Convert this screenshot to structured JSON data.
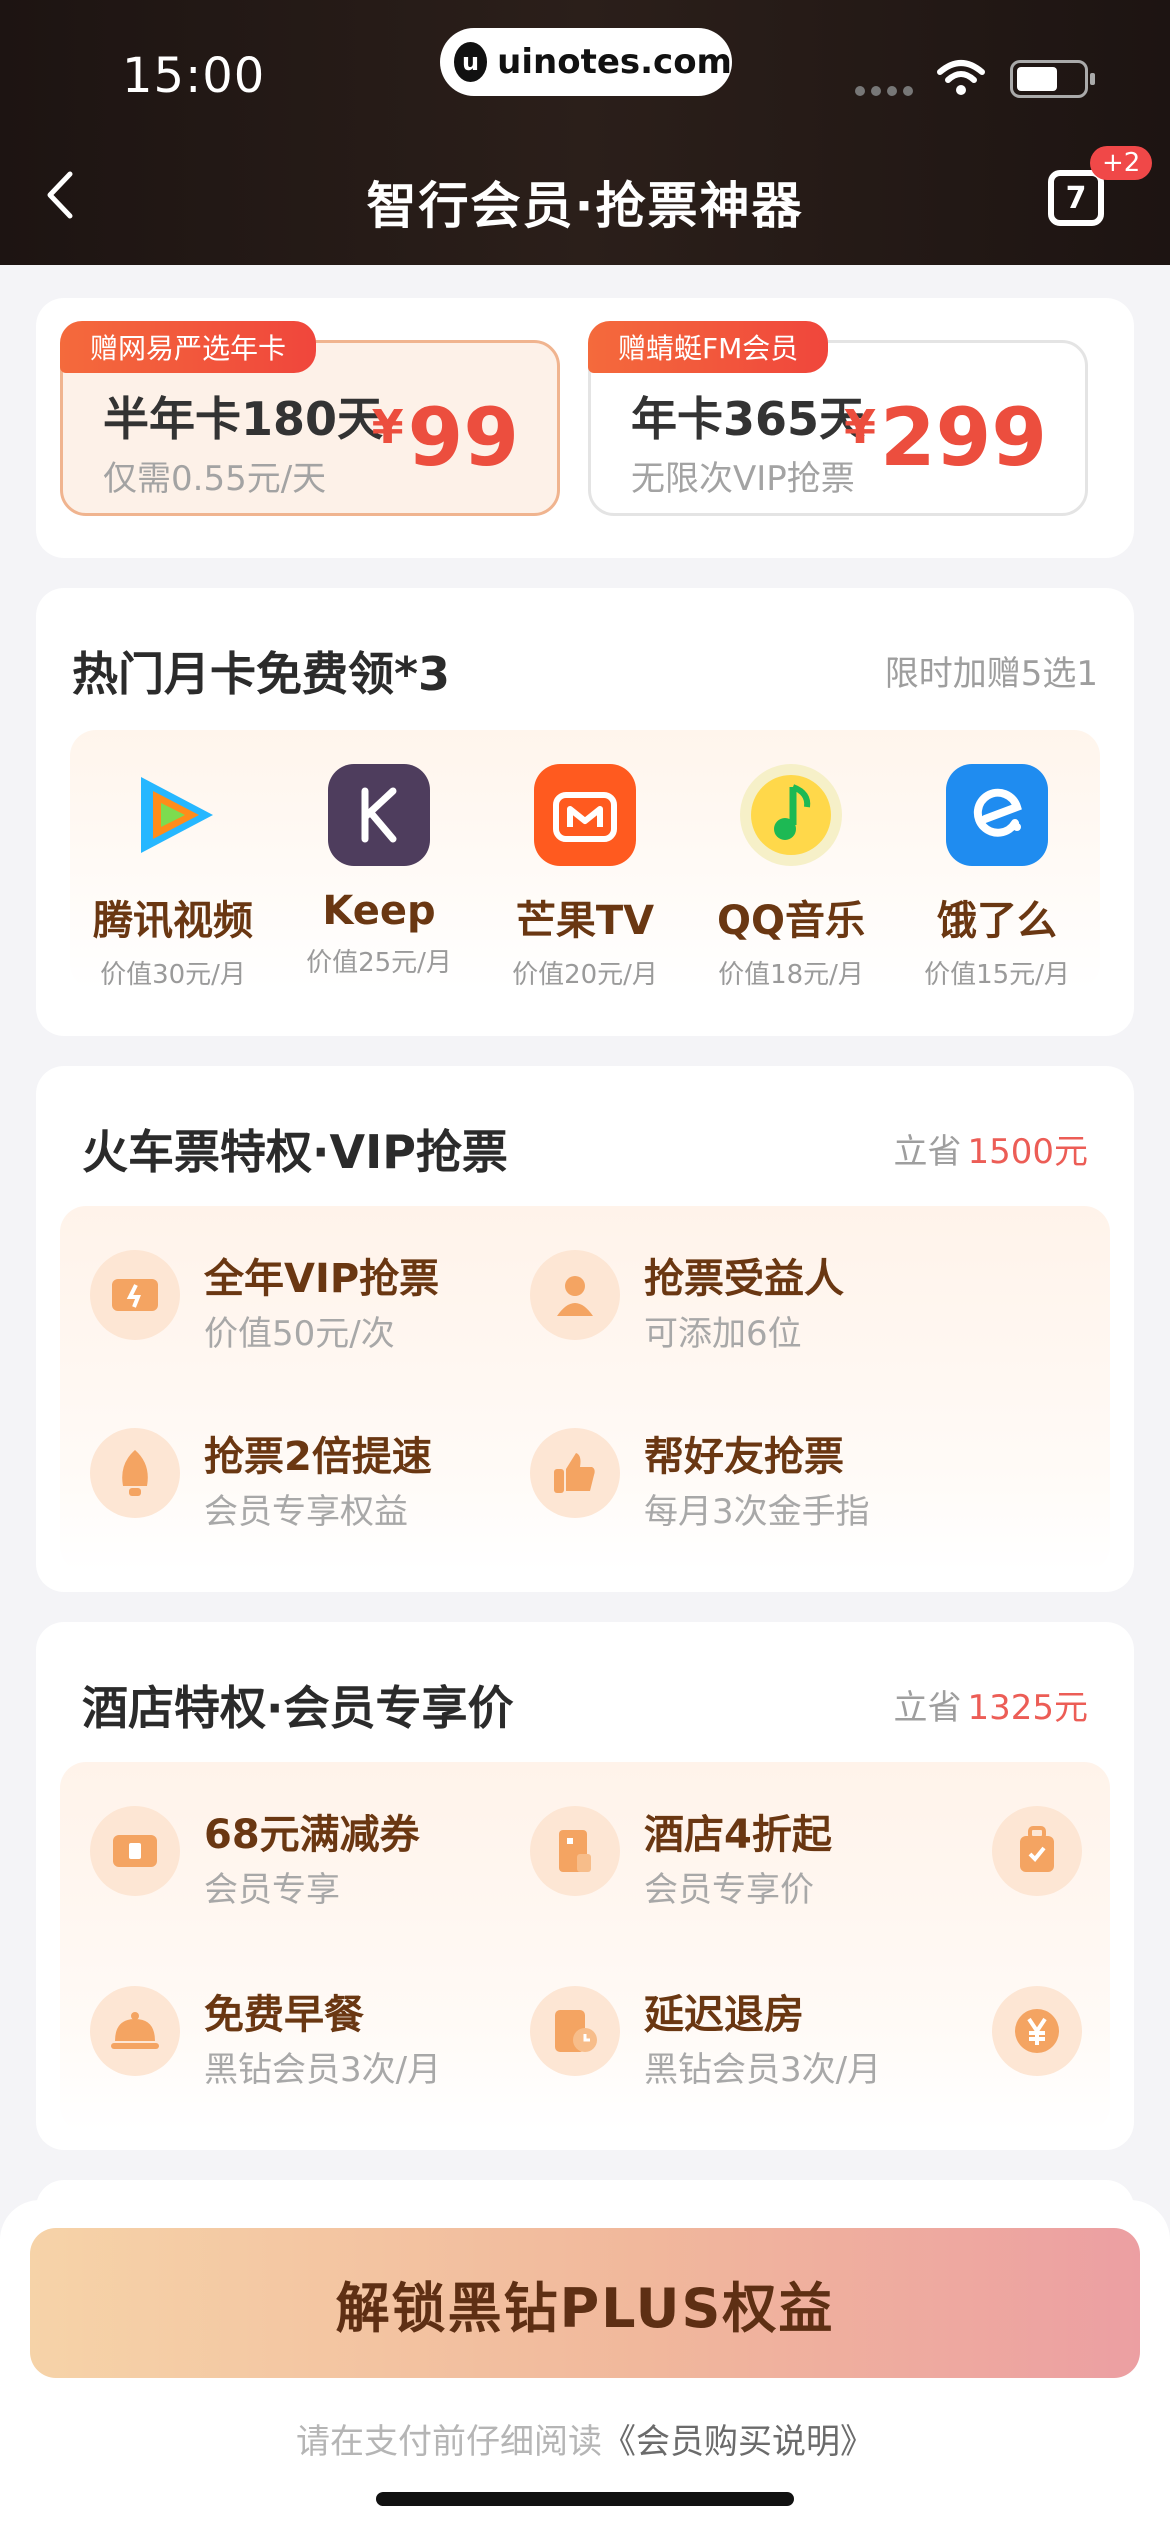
{
  "status_bar": {
    "time": "15:00",
    "url": "uinotes.com",
    "url_logo": "u"
  },
  "nav": {
    "title": "智行会员·抢票神器",
    "calendar_day": "7",
    "calendar_badge": "+2"
  },
  "plans": [
    {
      "tag": "赠网易严选年卡",
      "name": "半年卡180天",
      "sub": "仅需0.55元/天",
      "currency": "¥",
      "price": "99",
      "selected": true
    },
    {
      "tag": "赠蜻蜓FM会员",
      "name": "年卡365天",
      "sub": "无限次VIP抢票",
      "currency": "¥",
      "price": "299",
      "selected": false
    }
  ],
  "monthly": {
    "title": "热门月卡免费领*3",
    "note": "限时加赠5选1",
    "apps": [
      {
        "name": "腾讯视频",
        "value": "价值30元/月",
        "icon": "tencent-video-icon"
      },
      {
        "name": "Keep",
        "value": "价值25元/月",
        "icon": "keep-icon"
      },
      {
        "name": "芒果TV",
        "value": "价值20元/月",
        "icon": "mango-tv-icon"
      },
      {
        "name": "QQ音乐",
        "value": "价值18元/月",
        "icon": "qq-music-icon"
      },
      {
        "name": "饿了么",
        "value": "价值15元/月",
        "icon": "eleme-icon"
      }
    ]
  },
  "train": {
    "title": "火车票特权·VIP抢票",
    "save_prefix": "立省",
    "save_amount": "1500元",
    "items": [
      {
        "t1": "全年VIP抢票",
        "t2": "价值50元/次",
        "icon": "ticket-icon"
      },
      {
        "t1": "抢票受益人",
        "t2": "可添加6位",
        "icon": "person-icon"
      },
      {
        "t1": "抢票2倍提速",
        "t2": "会员专享权益",
        "icon": "rocket-icon"
      },
      {
        "t1": "帮好友抢票",
        "t2": "每月3次金手指",
        "icon": "thumbs-up-icon"
      }
    ]
  },
  "hotel": {
    "title": "酒店特权·会员专享价",
    "save_prefix": "立省",
    "save_amount": "1325元",
    "items": [
      {
        "t1": "68元满减券",
        "t2": "会员专享",
        "icon": "coupon-icon"
      },
      {
        "t1": "酒店4折起",
        "t2": "会员专享价",
        "icon": "hotel-building-icon"
      },
      {
        "t1": "免费早餐",
        "t2": "黑钻会员3次/月",
        "icon": "food-cloche-icon"
      },
      {
        "t1": "延迟退房",
        "t2": "黑钻会员3次/月",
        "icon": "late-checkout-icon"
      }
    ],
    "side_icons": [
      "luggage-icon",
      "yen-coin-icon"
    ]
  },
  "cta": {
    "label": "解锁黑钻PLUS权益"
  },
  "notice": {
    "text": "请在支付前仔细阅读",
    "link": "《会员购买说明》"
  },
  "colors": {
    "accent": "#ec4e3e",
    "brown": "#6a3712",
    "header": "#1d1412"
  }
}
